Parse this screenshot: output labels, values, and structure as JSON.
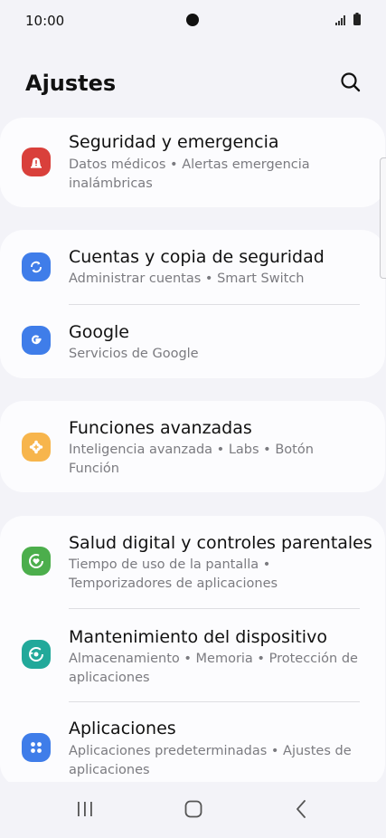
{
  "status_bar": {
    "time": "10:00"
  },
  "header": {
    "title": "Ajustes"
  },
  "colors": {
    "security": "#d9403b",
    "accounts": "#3f7de9",
    "google": "#3f7de9",
    "advanced": "#f7b54c",
    "wellbeing": "#4cae4c",
    "maintenance": "#22a99a",
    "apps": "#3f7de9"
  },
  "items": {
    "security": {
      "title": "Seguridad y emergencia",
      "subtitle": "Datos médicos  •  Alertas emergencia inalámbricas",
      "icon": "alert-icon"
    },
    "accounts": {
      "title": "Cuentas y copia de seguridad",
      "subtitle": "Administrar cuentas  •  Smart Switch",
      "icon": "sync-icon"
    },
    "google": {
      "title": "Google",
      "subtitle": "Servicios de Google",
      "icon": "google-icon"
    },
    "advanced": {
      "title": "Funciones avanzadas",
      "subtitle": "Inteligencia avanzada  •  Labs  •  Botón Función",
      "icon": "gear-plus-icon"
    },
    "wellbeing": {
      "title": "Salud digital y controles parentales",
      "subtitle": "Tiempo de uso de la pantalla  •  Temporizadores de aplicaciones",
      "icon": "heart-circle-icon"
    },
    "maintenance": {
      "title": "Mantenimiento del dispositivo",
      "subtitle": "Almacenamiento  •  Memoria  •  Protección de aplicaciones",
      "icon": "refresh-circle-icon"
    },
    "apps": {
      "title": "Aplicaciones",
      "subtitle": "Aplicaciones predeterminadas  •  Ajustes de aplicaciones",
      "icon": "grid-dots-icon"
    }
  }
}
